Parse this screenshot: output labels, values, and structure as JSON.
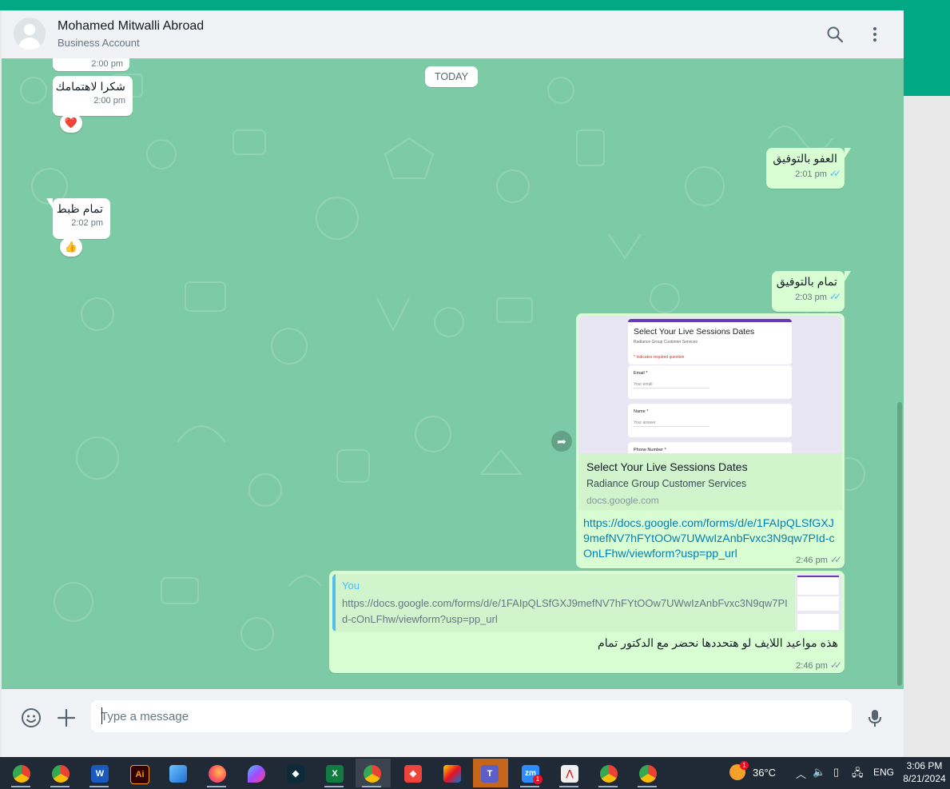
{
  "header": {
    "contact_name": "Mohamed Mitwalli Abroad",
    "contact_subtitle": "Business Account",
    "icons": [
      "search-icon",
      "menu-icon"
    ]
  },
  "chat": {
    "date_divider": "TODAY",
    "messages": [
      {
        "direction": "in",
        "time": "2:00 pm"
      },
      {
        "direction": "in",
        "text": "شكرا لاهتمامك",
        "time": "2:00 pm",
        "reaction": "❤️"
      },
      {
        "direction": "out",
        "text": "العفو بالتوفيق",
        "time": "2:01 pm",
        "status": "read"
      },
      {
        "direction": "in",
        "text": "تمام ظبط",
        "time": "2:02 pm",
        "reaction": "👍"
      },
      {
        "direction": "out",
        "text": "تمام بالتوفيق",
        "time": "2:03 pm",
        "status": "read"
      },
      {
        "direction": "out",
        "type": "link",
        "preview": {
          "image_title": "Select Your Live Sessions Dates",
          "image_subtitle": "Radiance Group Customer Services",
          "image_required_note": "* Indicates required question",
          "image_fields": [
            {
              "label": "Email *",
              "placeholder": "Your email"
            },
            {
              "label": "Name *",
              "placeholder": "Your answer"
            },
            {
              "label": "Phone Number *",
              "placeholder": ""
            }
          ],
          "title": "Select Your Live Sessions Dates",
          "description": "Radiance Group Customer Services",
          "domain": "docs.google.com"
        },
        "url": "https://docs.google.com/forms/d/e/1FAIpQLSfGXJ9mefNV7hFYtOOw7UWwIzAnbFvxc3N9qw7PId-cOnLFhw/viewform?usp=pp_url",
        "time": "2:46 pm",
        "status": "delivered"
      },
      {
        "direction": "out",
        "type": "reply",
        "quote": {
          "author": "You",
          "text": "https://docs.google.com/forms/d/e/1FAIpQLSfGXJ9mefNV7hFYtOOw7UWwIzAnbFvxc3N9qw7PId-cOnLFhw/viewform?usp=pp_url"
        },
        "text": "هذه مواعيد اللايف لو هتحددها نحضر مع الدكتور تمام",
        "time": "2:46 pm",
        "status": "delivered"
      }
    ]
  },
  "composer": {
    "placeholder": "Type a message",
    "icons": [
      "emoji-icon",
      "attach-plus-icon",
      "microphone-icon"
    ]
  },
  "taskbar": {
    "apps": [
      {
        "name": "Chrome",
        "icon": "chrome-icon",
        "color": "#e8453c"
      },
      {
        "name": "Chrome profile",
        "icon": "chrome-profile-icon",
        "color": "#34a853"
      },
      {
        "name": "Word",
        "icon": "word-icon",
        "color": "#185abd",
        "glyph": "W"
      },
      {
        "name": "Illustrator",
        "icon": "illustrator-icon",
        "color": "#330000",
        "glyph": "Ai"
      },
      {
        "name": "Paint",
        "icon": "paint-icon",
        "color": "#2f7de1"
      },
      {
        "name": "Firefox",
        "icon": "firefox-icon",
        "color": "#ff7139"
      },
      {
        "name": "Color picker",
        "icon": "droplet-icon",
        "color": "#a04cff"
      },
      {
        "name": "Filmora",
        "icon": "filmora-icon",
        "color": "#0b2a3a"
      },
      {
        "name": "Excel",
        "icon": "excel-icon",
        "color": "#107c41",
        "glyph": "X"
      },
      {
        "name": "Chrome active",
        "icon": "chrome-user-icon",
        "color": "#e8453c"
      },
      {
        "name": "AnyDesk",
        "icon": "anydesk-icon",
        "color": "#ef443b"
      },
      {
        "name": "Media",
        "icon": "media-icon",
        "color": "#d4b000"
      },
      {
        "name": "Teams",
        "icon": "teams-icon",
        "color": "#5b5fc7",
        "glyph": "T"
      },
      {
        "name": "Zoom",
        "icon": "zoom-icon",
        "color": "#2d8cff",
        "glyph": "zm",
        "badge": "1"
      },
      {
        "name": "Acrobat",
        "icon": "acrobat-icon",
        "color": "#d9d9d9"
      },
      {
        "name": "Chrome 2",
        "icon": "chrome-icon",
        "color": "#e8453c"
      },
      {
        "name": "Chrome A",
        "icon": "chrome-a-icon",
        "color": "#e8453c"
      }
    ],
    "weather": {
      "temperature": "36°C",
      "badge": "1"
    },
    "language": "ENG",
    "time": "3:06 PM",
    "date": "8/21/2024"
  },
  "colors": {
    "chat_bg": "#7dcba6",
    "outgoing_bubble": "#d9fdd3",
    "incoming_bubble": "#ffffff",
    "accent": "#00a884",
    "read_ticks": "#53bdeb",
    "link": "#027eb5"
  }
}
